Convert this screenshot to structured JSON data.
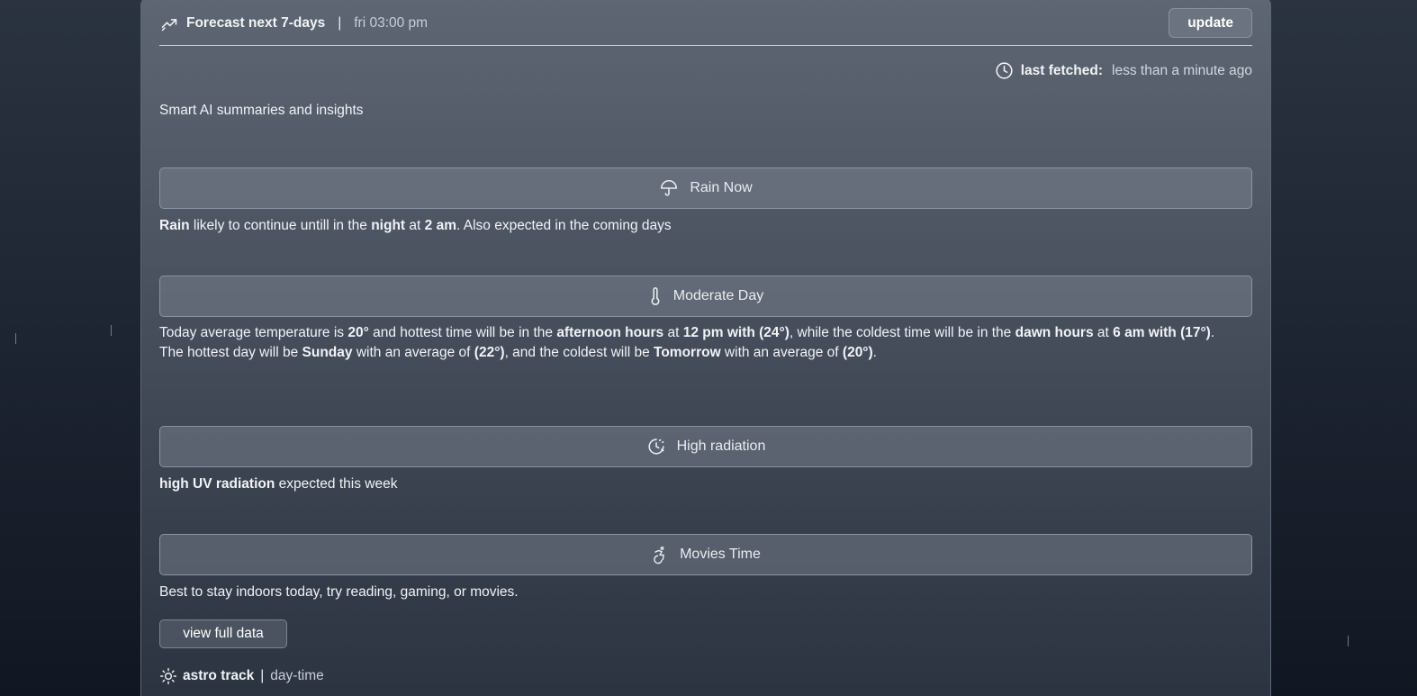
{
  "header": {
    "title": "Forecast next 7-days",
    "separator": "|",
    "time": "fri 03:00 pm",
    "update_label": "update",
    "icon": "trending-up-icon"
  },
  "fetched": {
    "label": "last fetched:",
    "value": "less than a minute ago",
    "icon": "clock-icon"
  },
  "subtitle": "Smart AI summaries and insights",
  "insights": [
    {
      "title": "Rain Now",
      "icon": "umbrella-icon",
      "text": [
        {
          "t": "Rain",
          "b": true
        },
        {
          "t": " likely to continue untill in the "
        },
        {
          "t": "night",
          "b": true
        },
        {
          "t": " at "
        },
        {
          "t": "2 am",
          "b": true
        },
        {
          "t": ". Also expected in the coming days"
        }
      ]
    },
    {
      "title": "Moderate Day",
      "icon": "thermometer-icon",
      "text": [
        {
          "t": "Today average temperature is "
        },
        {
          "t": "20°",
          "b": true
        },
        {
          "t": " and hottest time will be in the "
        },
        {
          "t": "afternoon hours",
          "b": true
        },
        {
          "t": " at "
        },
        {
          "t": "12 pm with (24°)",
          "b": true
        },
        {
          "t": ", while the coldest time will be in the "
        },
        {
          "t": "dawn hours",
          "b": true
        },
        {
          "t": " at "
        },
        {
          "t": "6 am with (17°)",
          "b": true
        },
        {
          "t": "."
        },
        {
          "br": true
        },
        {
          "t": "The hottest day will be "
        },
        {
          "t": "Sunday",
          "b": true
        },
        {
          "t": " with an average of "
        },
        {
          "t": "(22°)",
          "b": true
        },
        {
          "t": ", and the coldest will be "
        },
        {
          "t": "Tomorrow",
          "b": true
        },
        {
          "t": " with an average of "
        },
        {
          "t": "(20°)",
          "b": true
        },
        {
          "t": "."
        }
      ]
    },
    {
      "title": "High radiation",
      "icon": "sun-clock-icon",
      "text": [
        {
          "t": "high UV radiation",
          "b": true
        },
        {
          "t": " expected this week"
        }
      ]
    },
    {
      "title": "Movies Time",
      "icon": "accessibility-icon",
      "text": [
        {
          "t": "Best to stay indoors today, try reading, gaming, or movies."
        }
      ]
    }
  ],
  "view_full_data_label": "view full data",
  "astro": {
    "label": "astro track",
    "separator": "|",
    "value": "day-time",
    "icon": "sun-icon"
  }
}
